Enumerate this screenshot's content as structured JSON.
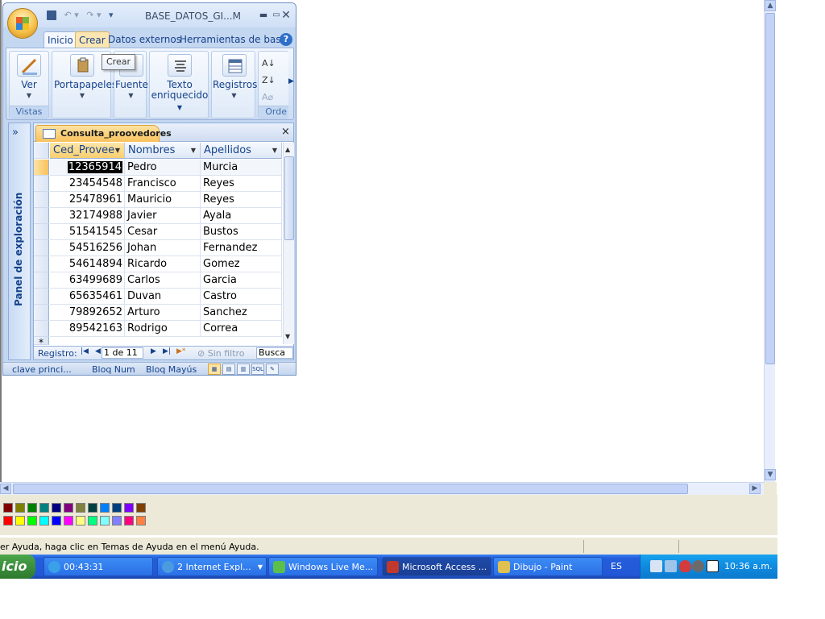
{
  "access": {
    "title": "BASE_DATOS_GI...M",
    "tabs": [
      "Inicio",
      "Crear",
      "Datos externos",
      "Herramientas de base"
    ],
    "help": "?",
    "ribbon": {
      "ver": "Ver",
      "vistas": "Vistas",
      "portapapeles": "Portapapeles",
      "fuente": "Fuente",
      "texto_line1": "Texto",
      "texto_line2": "enriquecido",
      "registros": "Registros",
      "ordenar": "Orde"
    },
    "tooltip": "Crear",
    "nav_pane": {
      "label": "Panel de exploración",
      "toggle": "»"
    },
    "document": {
      "tab_title": "Consulta_proovedores",
      "close": "×",
      "columns": [
        "Ced_Provee",
        "Nombres",
        "Apellidos"
      ],
      "rows": [
        [
          "12365914",
          "Pedro",
          "Murcia"
        ],
        [
          "23454548",
          "Francisco",
          "Reyes"
        ],
        [
          "25478961",
          "Mauricio",
          "Reyes"
        ],
        [
          "32174988",
          "Javier",
          "Ayala"
        ],
        [
          "51541545",
          "Cesar",
          "Bustos"
        ],
        [
          "54516256",
          "Johan",
          "Fernandez"
        ],
        [
          "54614894",
          "Ricardo",
          "Gomez"
        ],
        [
          "63499689",
          "Carlos",
          "Garcia"
        ],
        [
          "65635461",
          "Duvan",
          "Castro"
        ],
        [
          "79892652",
          "Arturo",
          "Sanchez"
        ],
        [
          "89542163",
          "Rodrigo",
          "Correa"
        ]
      ],
      "new_row_marker": "*",
      "record_nav": {
        "label": "Registro:",
        "position": "1 de 11",
        "filter": "Sin filtro",
        "search": "Busca"
      }
    },
    "status": {
      "left": "clave princi...",
      "numlock": "Bloq Num",
      "capslock": "Bloq Mayús"
    }
  },
  "paint": {
    "status_text": "er Ayuda, haga clic en Temas de Ayuda en el menú Ayuda.",
    "palette_top": [
      "#800000",
      "#808000",
      "#008000",
      "#008080",
      "#000080",
      "#800080",
      "#808040",
      "#004040",
      "#0080ff",
      "#004080",
      "#8000ff",
      "#804000"
    ],
    "palette_bottom": [
      "#ff0000",
      "#ffff00",
      "#00ff00",
      "#00ffff",
      "#0000ff",
      "#ff00ff",
      "#ffff80",
      "#00ff80",
      "#80ffff",
      "#8080ff",
      "#ff0080",
      "#ff8040"
    ]
  },
  "taskbar": {
    "start": "icio",
    "items": [
      {
        "label": "00:43:31",
        "color": "#3aa0e8"
      },
      {
        "label": "2 Internet Expl...",
        "color": "#4a9be0"
      },
      {
        "label": "Windows Live Me...",
        "color": "#5ac04a"
      },
      {
        "label": "Microsoft Access ...",
        "color": "#c0392b"
      },
      {
        "label": "Dibujo - Paint",
        "color": "#e0c050"
      }
    ],
    "language": "ES",
    "clock": "10:36 a.m."
  }
}
